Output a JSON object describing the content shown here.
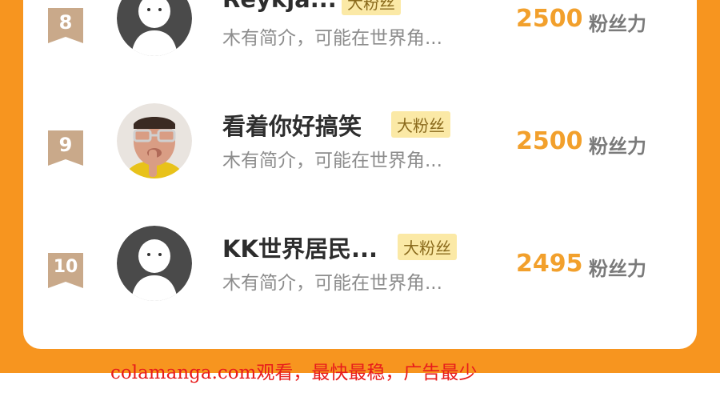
{
  "colors": {
    "background_orange": "#f7951f",
    "card": "#ffffff",
    "badge": "#c9a98a",
    "tag_bg": "#fbe9a6",
    "score": "#f2a02c",
    "watermark": "#e81c1c"
  },
  "ranking": {
    "rows": [
      {
        "rank": "8",
        "name": "Reykja...",
        "tag": "大粉丝",
        "intro": "木有简介，可能在世界角...",
        "score": "2500",
        "unit": "粉丝力",
        "avatar": "default-avatar-icon"
      },
      {
        "rank": "9",
        "name": "看着你好搞笑",
        "tag": "大粉丝",
        "intro": "木有简介，可能在世界角...",
        "score": "2500",
        "unit": "粉丝力",
        "avatar": "photo-avatar"
      },
      {
        "rank": "10",
        "name": "KK世界居民...",
        "tag": "大粉丝",
        "intro": "木有简介，可能在世界角...",
        "score": "2495",
        "unit": "粉丝力",
        "avatar": "default-avatar-icon"
      }
    ]
  },
  "watermark": {
    "text": "colamanga.com观看，最快最稳，广告最少"
  }
}
